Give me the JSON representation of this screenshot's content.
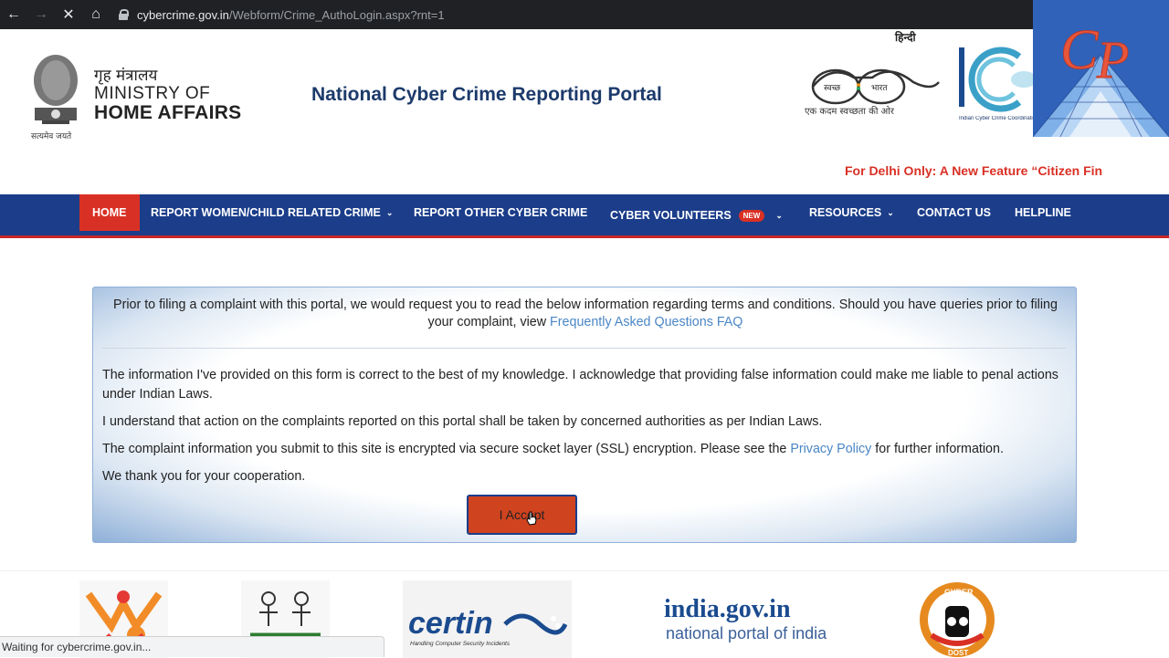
{
  "browser": {
    "url_host": "cybercrime.gov.in",
    "url_path": "/Webform/Crime_AuthoLogin.aspx?rnt=1",
    "status_text": "Waiting for cybercrime.gov.in..."
  },
  "header": {
    "mha_hindi": "गृह मंत्रालय",
    "mha_line1": "MINISTRY OF",
    "mha_line2": "HOME AFFAIRS",
    "emblem_caption": "सत्यमेव जयते",
    "portal_title": "National Cyber Crime Reporting Portal",
    "hindi_link": "हिन्दी",
    "swachh_label_1": "स्वच्छ",
    "swachh_label_2": "भारत",
    "swachh_caption": "एक कदम स्वच्छता की ओर",
    "i4c_caption": "Indian Cyber Crime Coordination",
    "ticker": "For Delhi Only: A New Feature “Citizen Fin"
  },
  "nav": {
    "home": "HOME",
    "women_child": "REPORT WOMEN/CHILD RELATED CRIME",
    "other": "REPORT OTHER CYBER CRIME",
    "volunteers": "CYBER VOLUNTEERS",
    "new_badge": "NEW",
    "resources": "RESOURCES",
    "contact": "CONTACT US",
    "helpline": "HELPLINE"
  },
  "terms": {
    "intro": "Prior to filing a complaint with this portal, we would request you to read the below information regarding terms and conditions. Should you have queries prior to filing your complaint, view ",
    "faq_link": "Frequently Asked Questions FAQ",
    "para1": "The information I've provided on this form is correct to the best of my knowledge. I acknowledge that providing false information could make me liable to penal actions under Indian Laws.",
    "para2": "I understand that action on the complaints reported on this portal shall be taken by concerned authorities as per Indian Laws.",
    "para3_before": "The complaint information you submit to this site is encrypted via secure socket layer (SSL) encryption. Please see the ",
    "privacy_link": "Privacy Policy",
    "para3_after": " for further information.",
    "para4": "We thank you for your cooperation.",
    "accept_button": "I Accept"
  },
  "partners": {
    "certin": "certin",
    "certin_sub": "Handling Computer Security Incidents",
    "indiagov_title": "india.gov.in",
    "indiagov_sub": "national portal of india",
    "cyberdost_top": "CYBER",
    "cyberdost_bottom": "DOST"
  },
  "colors": {
    "nav_bg": "#1b3d8a",
    "accent_red": "#d93025",
    "link": "#4a86c5",
    "title": "#1c3a6b"
  }
}
